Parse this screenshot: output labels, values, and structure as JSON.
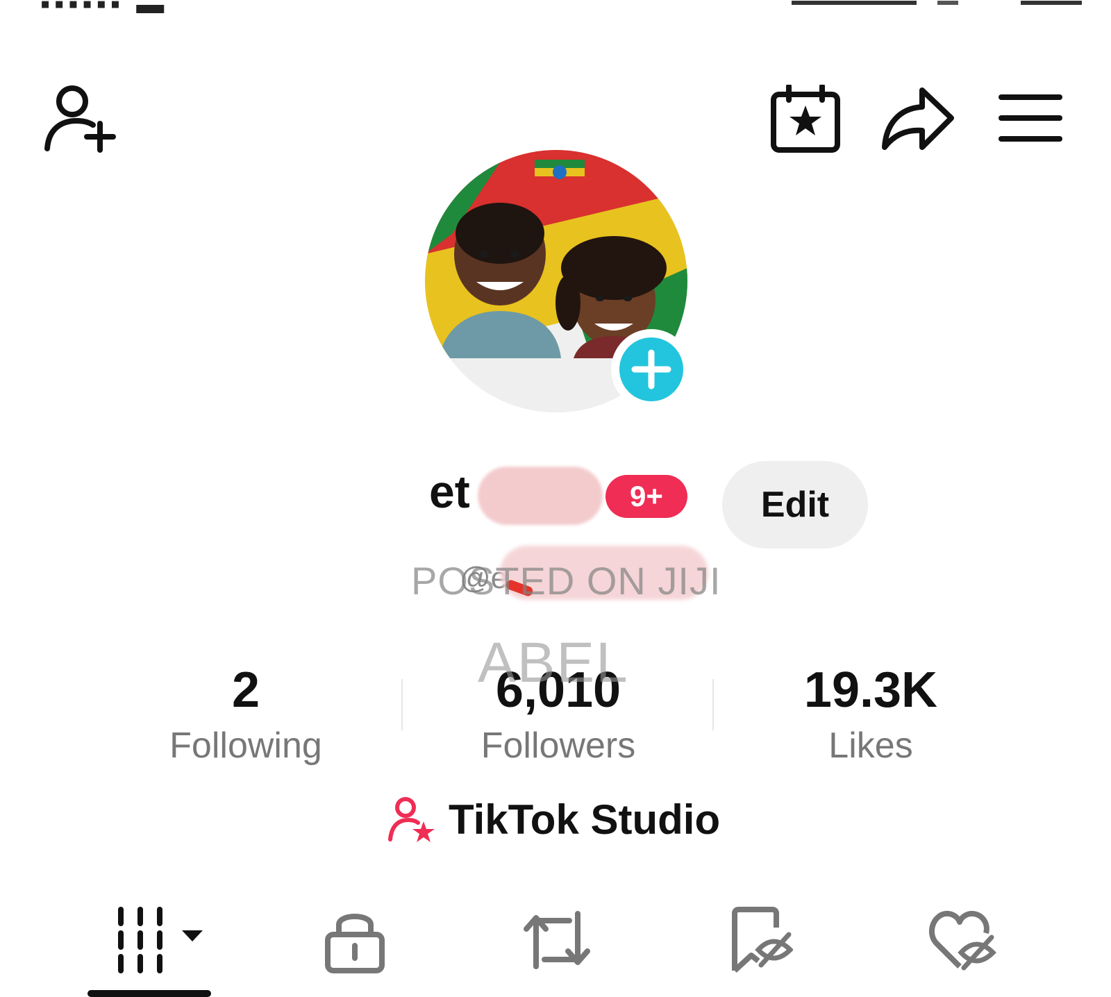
{
  "profile": {
    "display_name": "et",
    "notification_badge": "9+",
    "edit_label": "Edit",
    "username": "@e"
  },
  "watermark": {
    "line1": "POSTED ON JIJI",
    "line2": "ABEL"
  },
  "stats": [
    {
      "value": "2",
      "label": "Following"
    },
    {
      "value": "6,010",
      "label": "Followers"
    },
    {
      "value": "19.3K",
      "label": "Likes"
    }
  ],
  "studio": {
    "label": "TikTok Studio",
    "icon": "person-star-icon"
  },
  "top_bar": {
    "icons": [
      "add-friend-icon",
      "calendar-star-icon",
      "share-icon",
      "menu-icon"
    ]
  },
  "tabs": {
    "icons": [
      "videos-grid-icon",
      "lock-icon",
      "repost-icon",
      "favorites-hidden-icon",
      "liked-hidden-icon"
    ],
    "active_index": 0
  },
  "colors": {
    "badge": "#ef2d55",
    "avatar_add": "#22c5dd",
    "edit_bg": "#efefef",
    "studio_icon": "#ef2d55",
    "label_gray": "#777777"
  }
}
